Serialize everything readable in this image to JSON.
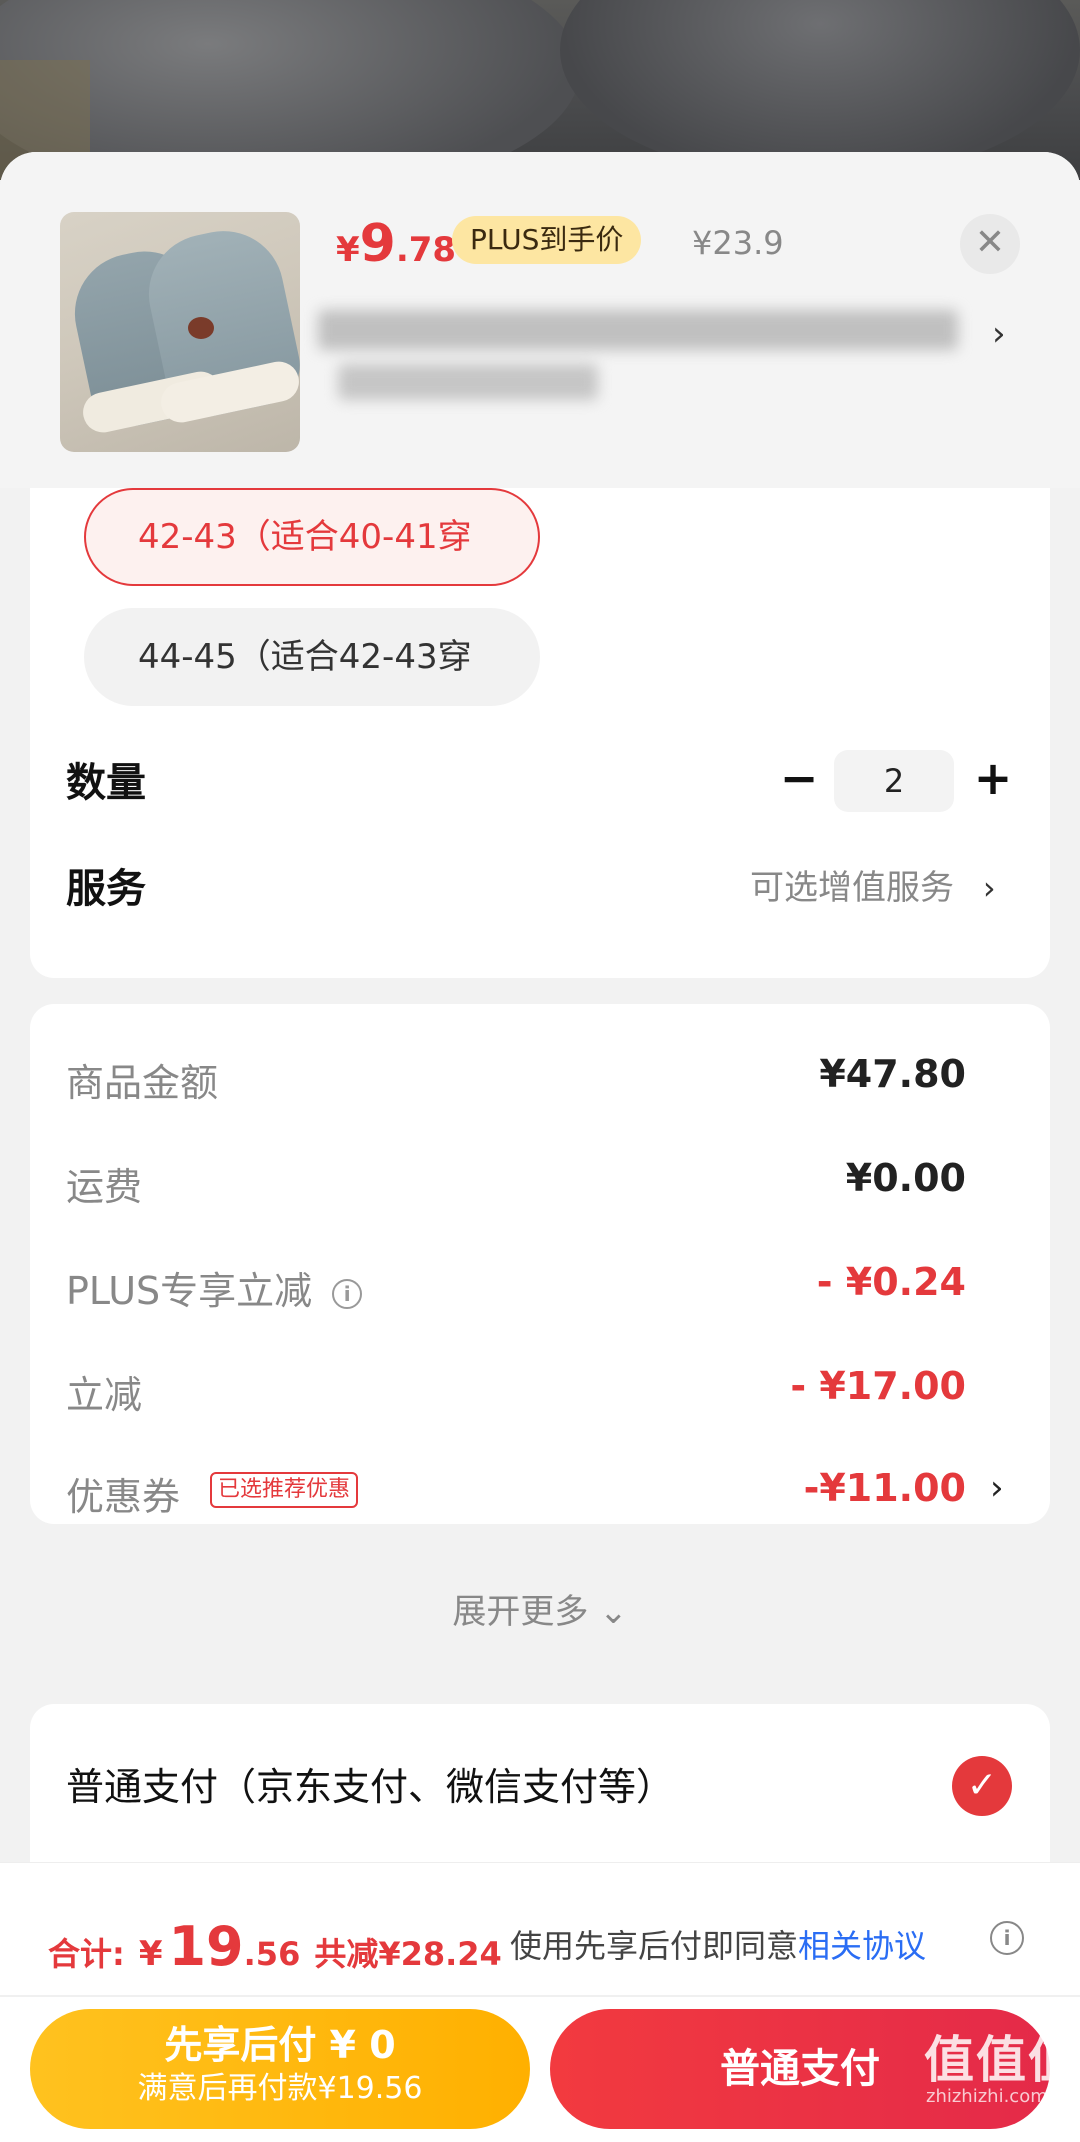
{
  "product": {
    "price_currency": "¥",
    "price_integer": "9",
    "price_decimal": ".78",
    "plus_badge": "PLUS到手价",
    "original_price": "¥23.9",
    "close_icon": "close-icon"
  },
  "spec": {
    "sizes": [
      {
        "label": "42-43（适合40-41穿",
        "selected": true
      },
      {
        "label": "44-45（适合42-43穿",
        "selected": false
      }
    ],
    "quantity_label": "数量",
    "quantity_minus": "−",
    "quantity_value": "2",
    "quantity_plus": "+",
    "service_label": "服务",
    "service_hint": "可选增值服务",
    "chevron": "›"
  },
  "fees": {
    "items": [
      {
        "label": "商品金额",
        "value": "¥47.80"
      },
      {
        "label": "运费",
        "value": "¥0.00"
      },
      {
        "label": "PLUS专享立减",
        "value": "- ¥0.24"
      },
      {
        "label": "立减",
        "value": "- ¥17.00"
      },
      {
        "label": "优惠券",
        "value": "-¥11.00"
      }
    ],
    "coupon_tag": "已选推荐优惠",
    "info_glyph": "i",
    "expand_label": "展开更多 ⌄"
  },
  "payment": {
    "option_label": "普通支付（京东支付、微信支付等）",
    "check_glyph": "✓"
  },
  "bottom": {
    "total_prefix": "合计:",
    "total_currency": "¥",
    "total_integer": "19",
    "total_decimal": ".56",
    "total_saved": "共减¥28.24",
    "agree_text": "使用先享后付即同意",
    "agree_link": "相关协议",
    "info_glyph": "i",
    "btn_later_line1": "先享后付 ¥ 0",
    "btn_later_line2": "满意后再付款¥19.56",
    "btn_normal": "普通支付"
  },
  "watermark": {
    "main": "值值值",
    "sub": "zhizhizhi.com"
  },
  "colors": {
    "accent_red": "#e4393c",
    "plus_gold": "#fde6a2",
    "link_blue": "#2a6df4",
    "later_button": "#ffb000"
  }
}
